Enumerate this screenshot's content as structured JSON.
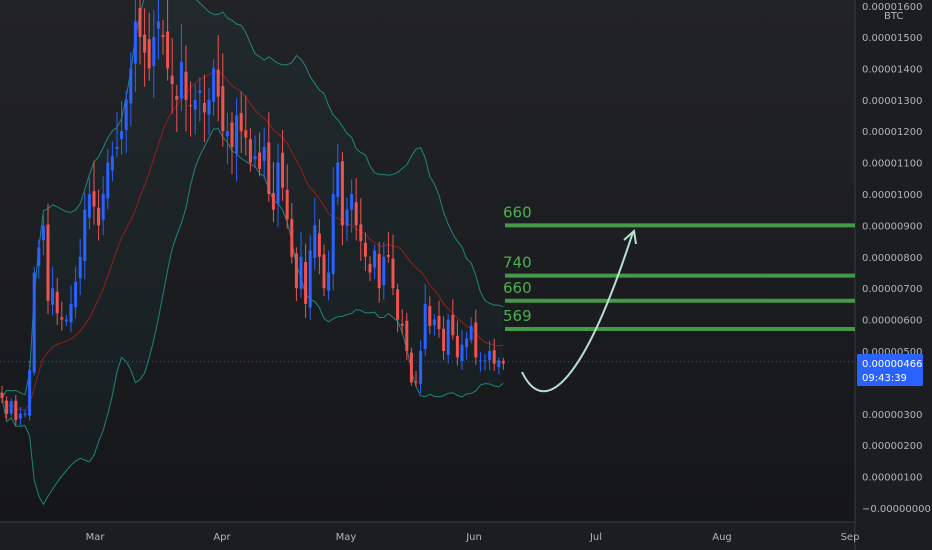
{
  "chart_data": {
    "type": "candlestick",
    "symbol_unit": "BTC",
    "y_axis": {
      "ylim": [
        -1e-07,
        1.6e-06
      ],
      "tick_labels": [
        "0.00001500",
        "0.00001400",
        "0.00001300",
        "0.00001200",
        "0.00001100",
        "0.00001000",
        "0.00000900",
        "0.00000800",
        "0.00000700",
        "0.00000600",
        "0.00000500",
        "0.00000300",
        "0.00000200",
        "0.00000100",
        "−0.00000000"
      ],
      "tick_values": [
        1.5e-06,
        1.4e-06,
        1.3e-06,
        1.2e-06,
        1.1e-06,
        1e-06,
        9e-07,
        8e-07,
        7e-07,
        6e-07,
        5e-07,
        3e-07,
        2e-07,
        1e-07,
        0.0
      ],
      "top_partial_label": "0.00001600"
    },
    "x_axis": {
      "tick_labels": [
        "Mar",
        "Apr",
        "May",
        "Jun",
        "Jul",
        "Aug",
        "Sep"
      ]
    },
    "price_label": {
      "value": "0.00000466",
      "countdown": "09:43:39",
      "price": 4.66e-07
    },
    "levels": [
      {
        "label": "660",
        "price": 9e-07,
        "color": "#4caf50"
      },
      {
        "label": "740",
        "price": 7.4e-07,
        "color": "#4caf50"
      },
      {
        "label": "660",
        "price": 6.6e-07,
        "color": "#4caf50"
      },
      {
        "label": "569",
        "price": 5.7e-07,
        "color": "#4caf50"
      }
    ],
    "grid": false,
    "legend": "none",
    "colors": {
      "up": "#2962ff",
      "down": "#ef5350",
      "bands": "#26a69a",
      "basis": "#b71c1c",
      "levels": "#4caf50",
      "projection": "#b9e0d4",
      "price_label_bg": "#2962ff"
    },
    "series_close_approx": [
      3.5e-07,
      3e-07,
      3.4e-07,
      2.8e-07,
      3e-07,
      3e-07,
      4.4e-07,
      7.5e-07,
      8.3e-07,
      9e-07,
      6.6e-07,
      7e-07,
      6.2e-07,
      6e-07,
      6e-07,
      6.5e-07,
      7.2e-07,
      8e-07,
      9.5e-07,
      1e-06,
      9.6e-07,
      9e-07,
      1e-06,
      1.1e-06,
      1.12e-06,
      1.15e-06,
      1.2e-06,
      1.3e-06,
      1.4e-06,
      1.55e-06,
      1.5e-06,
      1.45e-06,
      1.4e-06,
      1.5e-06,
      1.55e-06,
      1.5e-06,
      1.4e-06,
      1.35e-06,
      1.3e-06,
      1.42e-06,
      1.3e-06,
      1.28e-06,
      1.3e-06,
      1.33e-06,
      1.26e-06,
      1.3e-06,
      1.4e-06,
      1.31e-06,
      1.2e-06,
      1.2e-06,
      1.15e-06,
      1.25e-06,
      1.2e-06,
      1.18e-06,
      1.1e-06,
      1.12e-06,
      1.08e-06,
      1.15e-06,
      1e-06,
      9.5e-07,
      1.1e-06,
      1.02e-06,
      9.2e-07,
      8e-07,
      7e-07,
      8e-07,
      6.5e-07,
      8.2e-07,
      9e-07,
      8e-07,
      7e-07,
      7.5e-07,
      1e-06,
      1.1e-06,
      9e-07,
      9.5e-07,
      1e-06,
      9e-07,
      8.5e-07,
      8e-07,
      7.5e-07,
      8.2e-07,
      7e-07,
      8e-07,
      8e-07,
      7e-07,
      6e-07,
      5.8e-07,
      5e-07,
      4e-07,
      4e-07,
      5e-07,
      6.5e-07,
      5.8e-07,
      6e-07,
      5.7e-07,
      5e-07,
      6e-07,
      5.5e-07,
      4.8e-07,
      5.2e-07,
      5.4e-07,
      5.8e-07,
      4.8e-07,
      4.7e-07,
      4.7e-07,
      5e-07,
      4.6e-07,
      4.7e-07,
      4.6e-07
    ]
  }
}
